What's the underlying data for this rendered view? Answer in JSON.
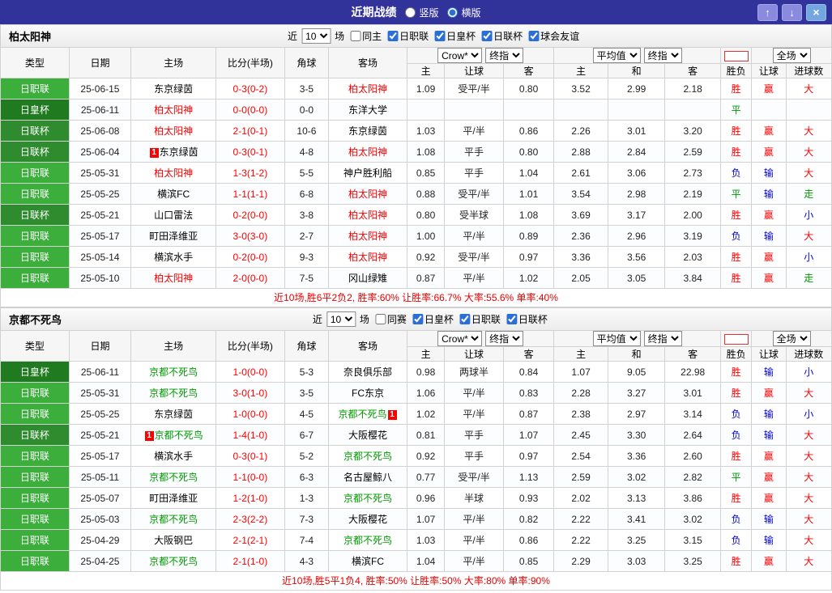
{
  "titlebar": {
    "title": "近期战绩",
    "radio_vertical": "竖版",
    "radio_horizontal": "横版",
    "selected": "横版"
  },
  "icons": {
    "up": "↑",
    "down": "↓",
    "close": "×"
  },
  "colors": {
    "titlebar_bg": "#32329B",
    "score_color": "#ff0000",
    "summary_color": "#e60000",
    "badge_bg": "#ff0000",
    "league_colors": {
      "日职联": "#3CAE3C",
      "日皇杯": "#207A20",
      "日联杯": "#2E8B2E"
    },
    "result_colors": {
      "胜": "#ff0000",
      "平": "#009900",
      "负": "#0000cc",
      "赢": "#ff0000",
      "输": "#0000cc",
      "走": "#009900",
      "大": "#ff0000",
      "小": "#0000cc"
    }
  },
  "sections": [
    {
      "team": "柏太阳神",
      "team_color": "#ff0000",
      "filter": {
        "near": "近",
        "rounds": "10",
        "games": "场",
        "same": "同主",
        "same_checked": false,
        "leagues": [
          {
            "label": "日职联",
            "checked": true
          },
          {
            "label": "日皇杯",
            "checked": true
          },
          {
            "label": "日联杯",
            "checked": true
          },
          {
            "label": "球会友谊",
            "checked": true
          }
        ]
      },
      "table": {
        "headers": [
          "类型",
          "日期",
          "主场",
          "比分(半场)",
          "角球",
          "客场"
        ],
        "group1_select1": "Crow*",
        "group1_select2": "终指",
        "group1_cols": [
          "主",
          "让球",
          "客"
        ],
        "group2_select1": "平均值",
        "group2_select2": "终指",
        "group2_cols": [
          "主",
          "和",
          "客"
        ],
        "group3_select": "全场",
        "group3_cols": [
          "胜负",
          "让球",
          "进球数"
        ],
        "rows": [
          {
            "type": "日职联",
            "date": "25-06-15",
            "home": "东京绿茵",
            "home_focus": false,
            "home_badge": "",
            "home_badge_after": false,
            "score": "0-3(0-2)",
            "corner": "3-5",
            "away": "柏太阳神",
            "away_focus": true,
            "away_badge": "",
            "away_badge_after": false,
            "odds": [
              "1.09",
              "受平/半",
              "0.80",
              "3.52",
              "2.99",
              "2.18"
            ],
            "results": [
              "胜",
              "赢",
              "大"
            ]
          },
          {
            "type": "日皇杯",
            "date": "25-06-11",
            "home": "柏太阳神",
            "home_focus": true,
            "home_badge": "",
            "home_badge_after": false,
            "score": "0-0(0-0)",
            "corner": "0-0",
            "away": "东洋大学",
            "away_focus": false,
            "away_badge": "",
            "away_badge_after": false,
            "odds": [
              "",
              "",
              "",
              "",
              "",
              ""
            ],
            "results": [
              "平",
              "",
              ""
            ]
          },
          {
            "type": "日联杯",
            "date": "25-06-08",
            "home": "柏太阳神",
            "home_focus": true,
            "home_badge": "",
            "home_badge_after": false,
            "score": "2-1(0-1)",
            "corner": "10-6",
            "away": "东京绿茵",
            "away_focus": false,
            "away_badge": "",
            "away_badge_after": false,
            "odds": [
              "1.03",
              "平/半",
              "0.86",
              "2.26",
              "3.01",
              "3.20"
            ],
            "results": [
              "胜",
              "赢",
              "大"
            ]
          },
          {
            "type": "日联杯",
            "date": "25-06-04",
            "home": "东京绿茵",
            "home_focus": false,
            "home_badge": "1",
            "home_badge_after": false,
            "score": "0-3(0-1)",
            "corner": "4-8",
            "away": "柏太阳神",
            "away_focus": true,
            "away_badge": "",
            "away_badge_after": false,
            "odds": [
              "1.08",
              "平手",
              "0.80",
              "2.88",
              "2.84",
              "2.59"
            ],
            "results": [
              "胜",
              "赢",
              "大"
            ]
          },
          {
            "type": "日职联",
            "date": "25-05-31",
            "home": "柏太阳神",
            "home_focus": true,
            "home_badge": "",
            "home_badge_after": false,
            "score": "1-3(1-2)",
            "corner": "5-5",
            "away": "神户胜利船",
            "away_focus": false,
            "away_badge": "",
            "away_badge_after": false,
            "odds": [
              "0.85",
              "平手",
              "1.04",
              "2.61",
              "3.06",
              "2.73"
            ],
            "results": [
              "负",
              "输",
              "大"
            ]
          },
          {
            "type": "日职联",
            "date": "25-05-25",
            "home": "横滨FC",
            "home_focus": false,
            "home_badge": "",
            "home_badge_after": false,
            "score": "1-1(1-1)",
            "corner": "6-8",
            "away": "柏太阳神",
            "away_focus": true,
            "away_badge": "",
            "away_badge_after": false,
            "odds": [
              "0.88",
              "受平/半",
              "1.01",
              "3.54",
              "2.98",
              "2.19"
            ],
            "results": [
              "平",
              "输",
              "走"
            ]
          },
          {
            "type": "日联杯",
            "date": "25-05-21",
            "home": "山口雷法",
            "home_focus": false,
            "home_badge": "",
            "home_badge_after": false,
            "score": "0-2(0-0)",
            "corner": "3-8",
            "away": "柏太阳神",
            "away_focus": true,
            "away_badge": "",
            "away_badge_after": false,
            "odds": [
              "0.80",
              "受半球",
              "1.08",
              "3.69",
              "3.17",
              "2.00"
            ],
            "results": [
              "胜",
              "赢",
              "小"
            ]
          },
          {
            "type": "日职联",
            "date": "25-05-17",
            "home": "町田泽维亚",
            "home_focus": false,
            "home_badge": "",
            "home_badge_after": false,
            "score": "3-0(3-0)",
            "corner": "2-7",
            "away": "柏太阳神",
            "away_focus": true,
            "away_badge": "",
            "away_badge_after": false,
            "odds": [
              "1.00",
              "平/半",
              "0.89",
              "2.36",
              "2.96",
              "3.19"
            ],
            "results": [
              "负",
              "输",
              "大"
            ]
          },
          {
            "type": "日职联",
            "date": "25-05-14",
            "home": "横滨水手",
            "home_focus": false,
            "home_badge": "",
            "home_badge_after": false,
            "score": "0-2(0-0)",
            "corner": "9-3",
            "away": "柏太阳神",
            "away_focus": true,
            "away_badge": "",
            "away_badge_after": false,
            "odds": [
              "0.92",
              "受平/半",
              "0.97",
              "3.36",
              "3.56",
              "2.03"
            ],
            "results": [
              "胜",
              "赢",
              "小"
            ]
          },
          {
            "type": "日职联",
            "date": "25-05-10",
            "home": "柏太阳神",
            "home_focus": true,
            "home_badge": "",
            "home_badge_after": false,
            "score": "2-0(0-0)",
            "corner": "7-5",
            "away": "冈山绿雉",
            "away_focus": false,
            "away_badge": "",
            "away_badge_after": false,
            "odds": [
              "0.87",
              "平/半",
              "1.02",
              "2.05",
              "3.05",
              "3.84"
            ],
            "results": [
              "胜",
              "赢",
              "走"
            ]
          }
        ]
      },
      "summary": "近10场,胜6平2负2, 胜率:60% 让胜率:66.7% 大率:55.6% 单率:40%"
    },
    {
      "team": "京都不死鸟",
      "team_color": "#009900",
      "filter": {
        "near": "近",
        "rounds": "10",
        "games": "场",
        "same": "同赛",
        "same_checked": false,
        "leagues": [
          {
            "label": "日皇杯",
            "checked": true
          },
          {
            "label": "日职联",
            "checked": true
          },
          {
            "label": "日联杯",
            "checked": true
          }
        ]
      },
      "table": {
        "headers": [
          "类型",
          "日期",
          "主场",
          "比分(半场)",
          "角球",
          "客场"
        ],
        "group1_select1": "Crow*",
        "group1_select2": "终指",
        "group1_cols": [
          "主",
          "让球",
          "客"
        ],
        "group2_select1": "平均值",
        "group2_select2": "终指",
        "group2_cols": [
          "主",
          "和",
          "客"
        ],
        "group3_select": "全场",
        "group3_cols": [
          "胜负",
          "让球",
          "进球数"
        ],
        "rows": [
          {
            "type": "日皇杯",
            "date": "25-06-11",
            "home": "京都不死鸟",
            "home_focus": true,
            "home_badge": "",
            "home_badge_after": false,
            "score": "1-0(0-0)",
            "corner": "5-3",
            "away": "奈良俱乐部",
            "away_focus": false,
            "away_badge": "",
            "away_badge_after": false,
            "odds": [
              "0.98",
              "两球半",
              "0.84",
              "1.07",
              "9.05",
              "22.98"
            ],
            "results": [
              "胜",
              "输",
              "小"
            ]
          },
          {
            "type": "日职联",
            "date": "25-05-31",
            "home": "京都不死鸟",
            "home_focus": true,
            "home_badge": "",
            "home_badge_after": false,
            "score": "3-0(1-0)",
            "corner": "3-5",
            "away": "FC东京",
            "away_focus": false,
            "away_badge": "",
            "away_badge_after": false,
            "odds": [
              "1.06",
              "平/半",
              "0.83",
              "2.28",
              "3.27",
              "3.01"
            ],
            "results": [
              "胜",
              "赢",
              "大"
            ]
          },
          {
            "type": "日职联",
            "date": "25-05-25",
            "home": "东京绿茵",
            "home_focus": false,
            "home_badge": "",
            "home_badge_after": false,
            "score": "1-0(0-0)",
            "corner": "4-5",
            "away": "京都不死鸟",
            "away_focus": true,
            "away_badge": "1",
            "away_badge_after": true,
            "odds": [
              "1.02",
              "平/半",
              "0.87",
              "2.38",
              "2.97",
              "3.14"
            ],
            "results": [
              "负",
              "输",
              "小"
            ]
          },
          {
            "type": "日联杯",
            "date": "25-05-21",
            "home": "京都不死鸟",
            "home_focus": true,
            "home_badge": "1",
            "home_badge_after": false,
            "score": "1-4(1-0)",
            "corner": "6-7",
            "away": "大阪樱花",
            "away_focus": false,
            "away_badge": "",
            "away_badge_after": false,
            "odds": [
              "0.81",
              "平手",
              "1.07",
              "2.45",
              "3.30",
              "2.64"
            ],
            "results": [
              "负",
              "输",
              "大"
            ]
          },
          {
            "type": "日职联",
            "date": "25-05-17",
            "home": "横滨水手",
            "home_focus": false,
            "home_badge": "",
            "home_badge_after": false,
            "score": "0-3(0-1)",
            "corner": "5-2",
            "away": "京都不死鸟",
            "away_focus": true,
            "away_badge": "",
            "away_badge_after": false,
            "odds": [
              "0.92",
              "平手",
              "0.97",
              "2.54",
              "3.36",
              "2.60"
            ],
            "results": [
              "胜",
              "赢",
              "大"
            ]
          },
          {
            "type": "日职联",
            "date": "25-05-11",
            "home": "京都不死鸟",
            "home_focus": true,
            "home_badge": "",
            "home_badge_after": false,
            "score": "1-1(0-0)",
            "corner": "6-3",
            "away": "名古屋鲸八",
            "away_focus": false,
            "away_badge": "",
            "away_badge_after": false,
            "odds": [
              "0.77",
              "受平/半",
              "1.13",
              "2.59",
              "3.02",
              "2.82"
            ],
            "results": [
              "平",
              "赢",
              "大"
            ]
          },
          {
            "type": "日职联",
            "date": "25-05-07",
            "home": "町田泽维亚",
            "home_focus": false,
            "home_badge": "",
            "home_badge_after": false,
            "score": "1-2(1-0)",
            "corner": "1-3",
            "away": "京都不死鸟",
            "away_focus": true,
            "away_badge": "",
            "away_badge_after": false,
            "odds": [
              "0.96",
              "半球",
              "0.93",
              "2.02",
              "3.13",
              "3.86"
            ],
            "results": [
              "胜",
              "赢",
              "大"
            ]
          },
          {
            "type": "日职联",
            "date": "25-05-03",
            "home": "京都不死鸟",
            "home_focus": true,
            "home_badge": "",
            "home_badge_after": false,
            "score": "2-3(2-2)",
            "corner": "7-3",
            "away": "大阪樱花",
            "away_focus": false,
            "away_badge": "",
            "away_badge_after": false,
            "odds": [
              "1.07",
              "平/半",
              "0.82",
              "2.22",
              "3.41",
              "3.02"
            ],
            "results": [
              "负",
              "输",
              "大"
            ]
          },
          {
            "type": "日职联",
            "date": "25-04-29",
            "home": "大阪钢巴",
            "home_focus": false,
            "home_badge": "",
            "home_badge_after": false,
            "score": "2-1(2-1)",
            "corner": "7-4",
            "away": "京都不死鸟",
            "away_focus": true,
            "away_badge": "",
            "away_badge_after": false,
            "odds": [
              "1.03",
              "平/半",
              "0.86",
              "2.22",
              "3.25",
              "3.15"
            ],
            "results": [
              "负",
              "输",
              "大"
            ]
          },
          {
            "type": "日职联",
            "date": "25-04-25",
            "home": "京都不死鸟",
            "home_focus": true,
            "home_badge": "",
            "home_badge_after": false,
            "score": "2-1(1-0)",
            "corner": "4-3",
            "away": "横滨FC",
            "away_focus": false,
            "away_badge": "",
            "away_badge_after": false,
            "odds": [
              "1.04",
              "平/半",
              "0.85",
              "2.29",
              "3.03",
              "3.25"
            ],
            "results": [
              "胜",
              "赢",
              "大"
            ]
          }
        ]
      },
      "summary": "近10场,胜5平1负4, 胜率:50% 让胜率:50% 大率:80% 单率:90%"
    }
  ]
}
